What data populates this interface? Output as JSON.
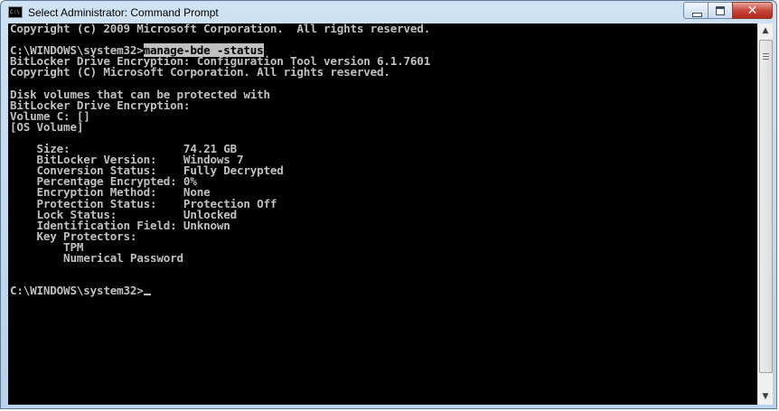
{
  "window": {
    "title": "Select Administrator: Command Prompt",
    "icon_label": "C:\\"
  },
  "controls": {
    "minimize_icon": "minimize-icon",
    "maximize_icon": "maximize-icon",
    "close_icon": "close-icon",
    "close_glyph": "✕"
  },
  "console": {
    "line1": "Copyright (c) 2009 Microsoft Corporation.  All rights reserved.",
    "line2": "",
    "prompt1": "C:\\WINDOWS\\system32>",
    "command1": "manage-bde -status",
    "line4": "BitLocker Drive Encryption: Configuration Tool version 6.1.7601",
    "line5": "Copyright (C) Microsoft Corporation. All rights reserved.",
    "line6": "",
    "line7": "Disk volumes that can be protected with",
    "line8": "BitLocker Drive Encryption:",
    "line9": "Volume C: []",
    "line10": "[OS Volume]",
    "line11": "",
    "line12": "    Size:                 74.21 GB",
    "line13": "    BitLocker Version:    Windows 7",
    "line14": "    Conversion Status:    Fully Decrypted",
    "line15": "    Percentage Encrypted: 0%",
    "line16": "    Encryption Method:    None",
    "line17": "    Protection Status:    Protection Off",
    "line18": "    Lock Status:          Unlocked",
    "line19": "    Identification Field: Unknown",
    "line20": "    Key Protectors:",
    "line21": "        TPM",
    "line22": "        Numerical Password",
    "line23": "",
    "line24": "",
    "prompt2": "C:\\WINDOWS\\system32>"
  },
  "scrollbar": {
    "up_arrow": "▲",
    "down_arrow": "▼"
  }
}
